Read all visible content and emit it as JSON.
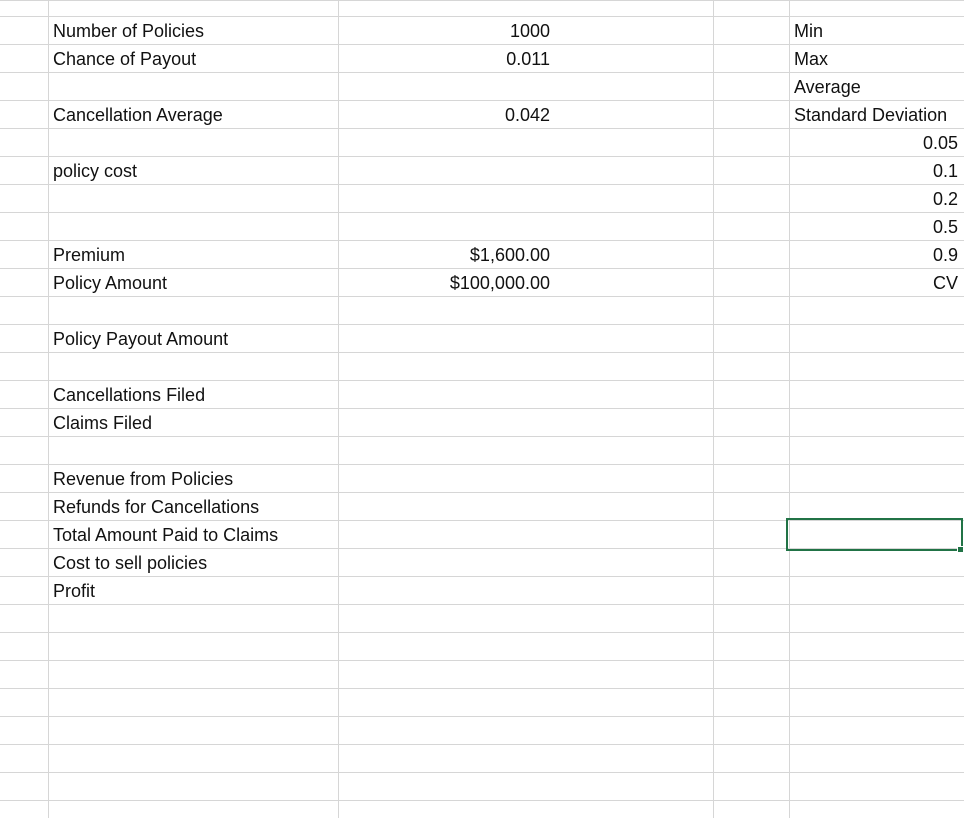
{
  "sheet": {
    "left_labels": [
      "Number of Policies",
      "Chance of Payout",
      "Cancellation Average",
      "policy cost",
      "Premium",
      "Policy Amount",
      "Policy Payout Amount",
      "Cancellations Filed",
      "Claims Filed",
      "Revenue from Policies",
      "Refunds for Cancellations",
      "Total Amount Paid to Claims",
      "Cost to sell policies",
      "Profit"
    ],
    "values": {
      "number_of_policies": "1000",
      "chance_of_payout": "0.011",
      "cancellation_average": "0.042",
      "premium": "$1,600.00",
      "policy_amount": "$100,000.00"
    },
    "stats_labels": [
      "Min",
      "Max",
      "Average",
      "Standard Deviation"
    ],
    "stats_values": [
      "0.05",
      "0.1",
      "0.2",
      "0.5",
      "0.9",
      "CV"
    ],
    "selection_color": "#217346",
    "gridline_color": "#d6d6d6"
  }
}
